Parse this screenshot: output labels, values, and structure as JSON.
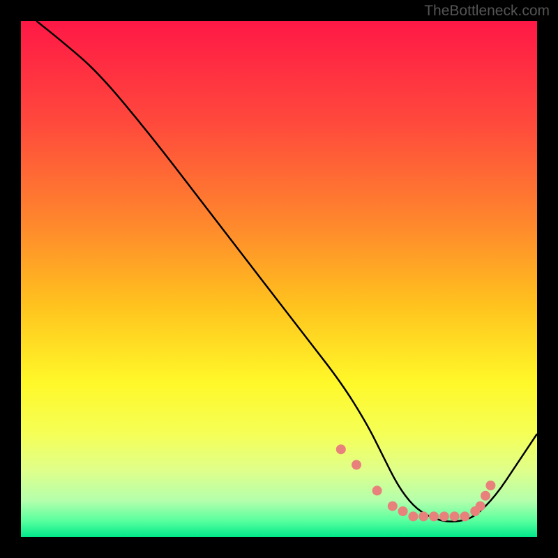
{
  "watermark": "TheBottleneck.com",
  "chart_data": {
    "type": "line",
    "title": "",
    "xlabel": "",
    "ylabel": "",
    "xlim": [
      0,
      100
    ],
    "ylim": [
      0,
      100
    ],
    "grid": false,
    "legend": false,
    "series": [
      {
        "name": "curve",
        "x": [
          3,
          8,
          15,
          25,
          35,
          45,
          55,
          62,
          67,
          70,
          73,
          76,
          79,
          82,
          85,
          88,
          92,
          96,
          100
        ],
        "values": [
          100,
          96,
          90,
          78,
          65,
          52,
          39,
          30,
          22,
          16,
          10,
          6,
          4,
          3,
          3,
          4,
          8,
          14,
          20
        ]
      }
    ],
    "markers": {
      "name": "dots",
      "color": "#e8817b",
      "x": [
        62,
        65,
        69,
        72,
        74,
        76,
        78,
        80,
        82,
        84,
        86,
        88,
        89,
        90,
        91
      ],
      "values": [
        17,
        14,
        9,
        6,
        5,
        4,
        4,
        4,
        4,
        4,
        4,
        5,
        6,
        8,
        10
      ]
    },
    "background_gradient": {
      "type": "vertical",
      "stops": [
        {
          "pos": 0.0,
          "color": "#ff1846"
        },
        {
          "pos": 0.2,
          "color": "#ff4a3c"
        },
        {
          "pos": 0.4,
          "color": "#ff8a2c"
        },
        {
          "pos": 0.55,
          "color": "#ffc21e"
        },
        {
          "pos": 0.7,
          "color": "#fff829"
        },
        {
          "pos": 0.8,
          "color": "#f5ff56"
        },
        {
          "pos": 0.87,
          "color": "#e0ff8a"
        },
        {
          "pos": 0.93,
          "color": "#b3ffac"
        },
        {
          "pos": 0.97,
          "color": "#55ff9e"
        },
        {
          "pos": 1.0,
          "color": "#00e88a"
        }
      ]
    }
  }
}
